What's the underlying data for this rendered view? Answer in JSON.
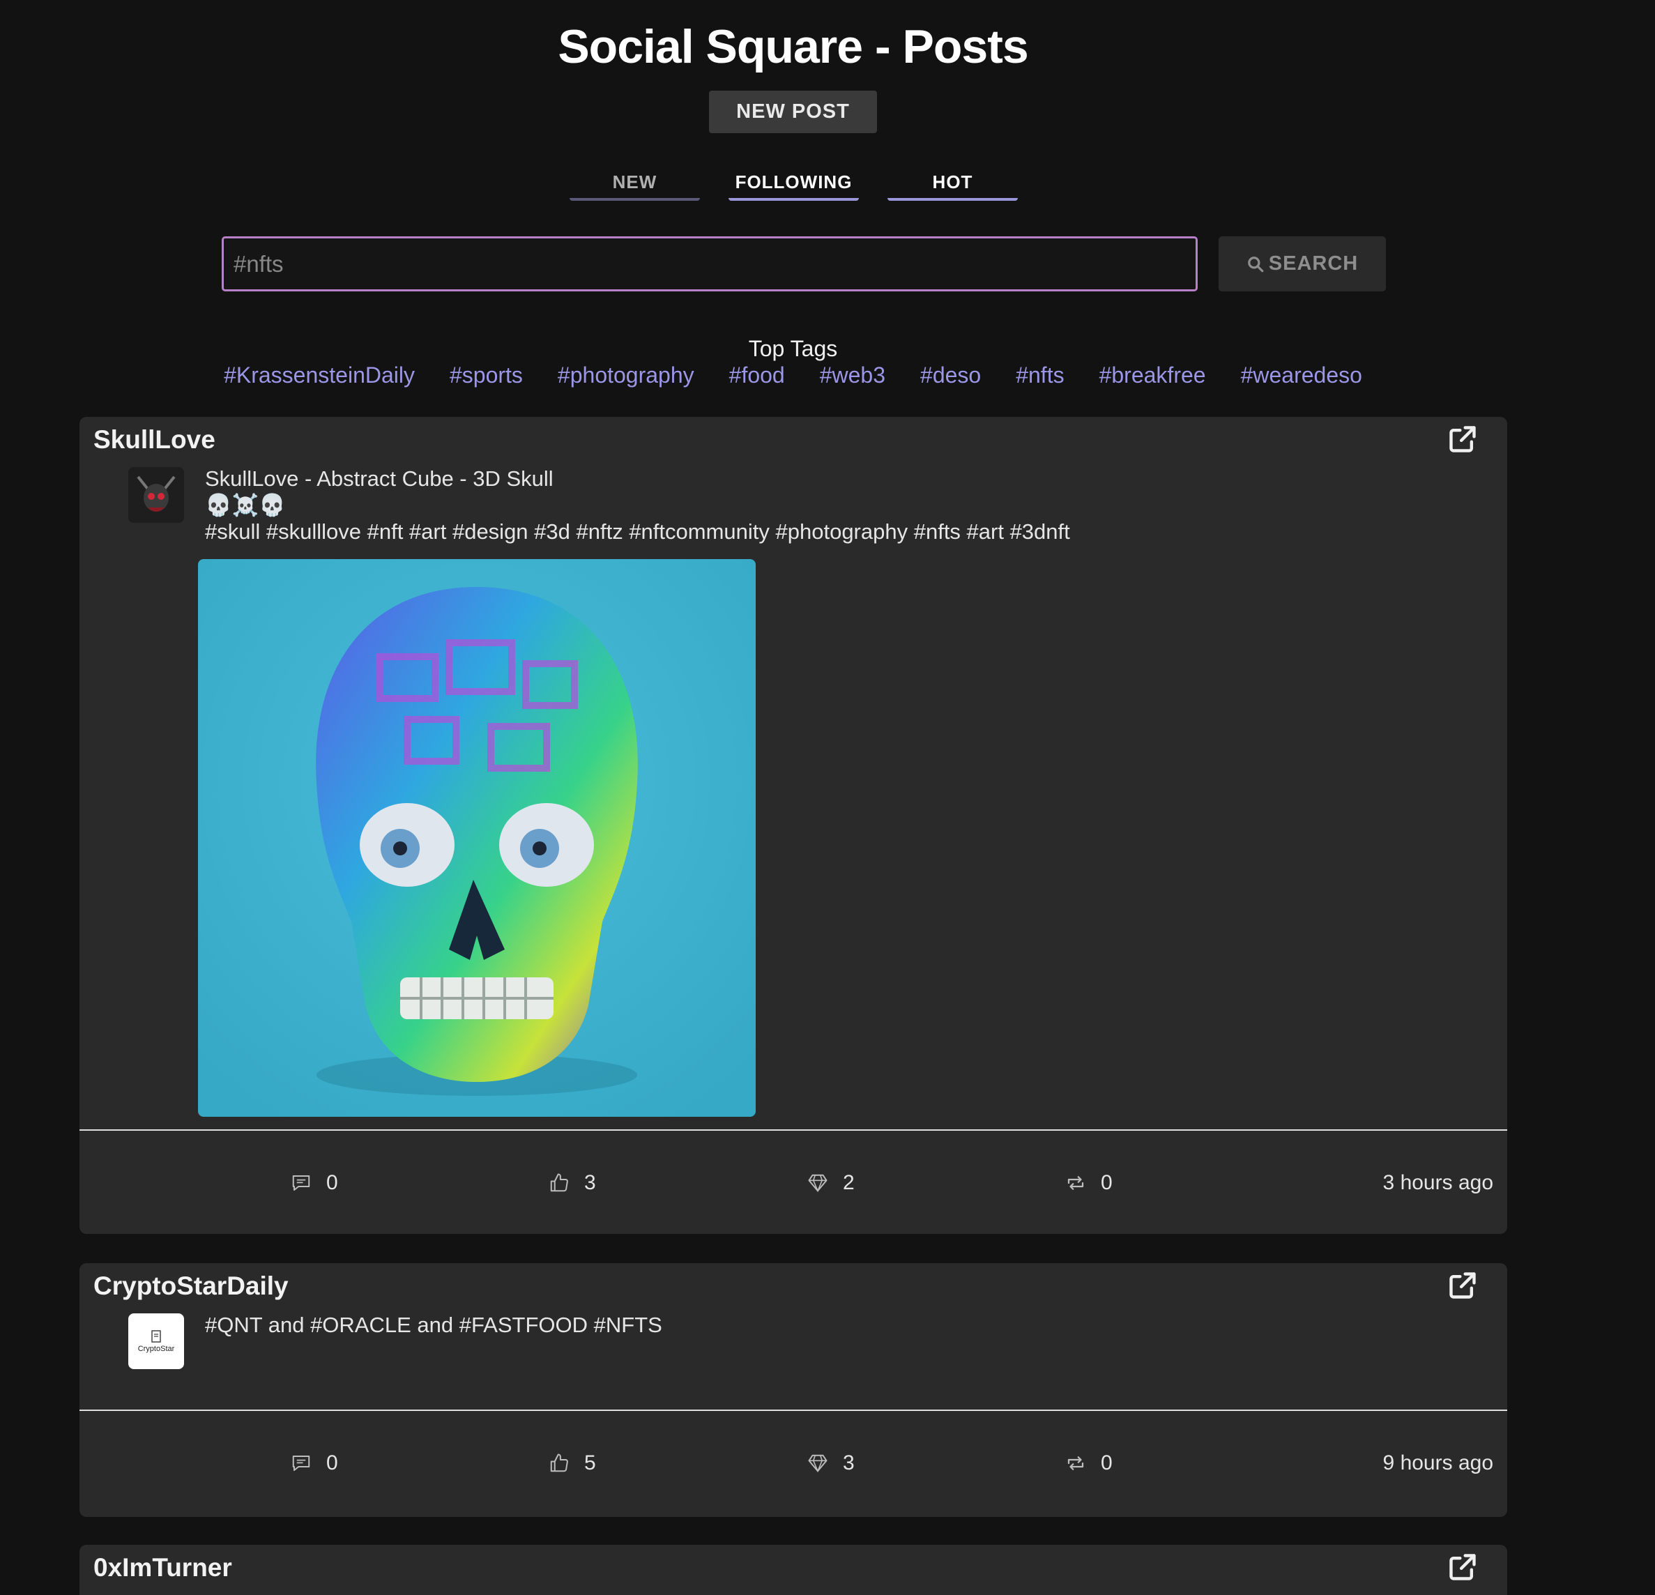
{
  "header": {
    "title": "Social Square - Posts",
    "new_post_label": "NEW POST"
  },
  "tabs": [
    {
      "label": "NEW",
      "active": false
    },
    {
      "label": "FOLLOWING",
      "active": false
    },
    {
      "label": "HOT",
      "active": true
    }
  ],
  "search": {
    "value": "#nfts",
    "button_label": "SEARCH"
  },
  "top_tags": {
    "label": "Top Tags",
    "tags": [
      "#KrassensteinDaily",
      "#sports",
      "#photography",
      "#food",
      "#web3",
      "#deso",
      "#nfts",
      "#breakfree",
      "#wearedeso"
    ]
  },
  "colors": {
    "background": "#121212",
    "card": "#2a2a2a",
    "accent_tag": "#9b96e6",
    "search_border": "#b780c9",
    "active_tab_underline": "#9b96d9"
  },
  "posts": [
    {
      "author": "SkullLove",
      "text": "SkullLove - Abstract Cube - 3D Skull\n💀☠️💀\n#skull #skulllove #nft #art #design #3d #nftz #nftcommunity #photography #nfts #art #3dnft",
      "has_image": true,
      "comments": "0",
      "likes": "3",
      "diamonds": "2",
      "reposts": "0",
      "time": "3 hours ago"
    },
    {
      "author": "CryptoStarDaily",
      "text": "#QNT and #ORACLE and #FASTFOOD #NFTS",
      "avatar_text": "CryptoStar",
      "has_image": false,
      "comments": "0",
      "likes": "5",
      "diamonds": "3",
      "reposts": "0",
      "time": "9 hours ago"
    },
    {
      "author": "0xImTurner"
    }
  ]
}
